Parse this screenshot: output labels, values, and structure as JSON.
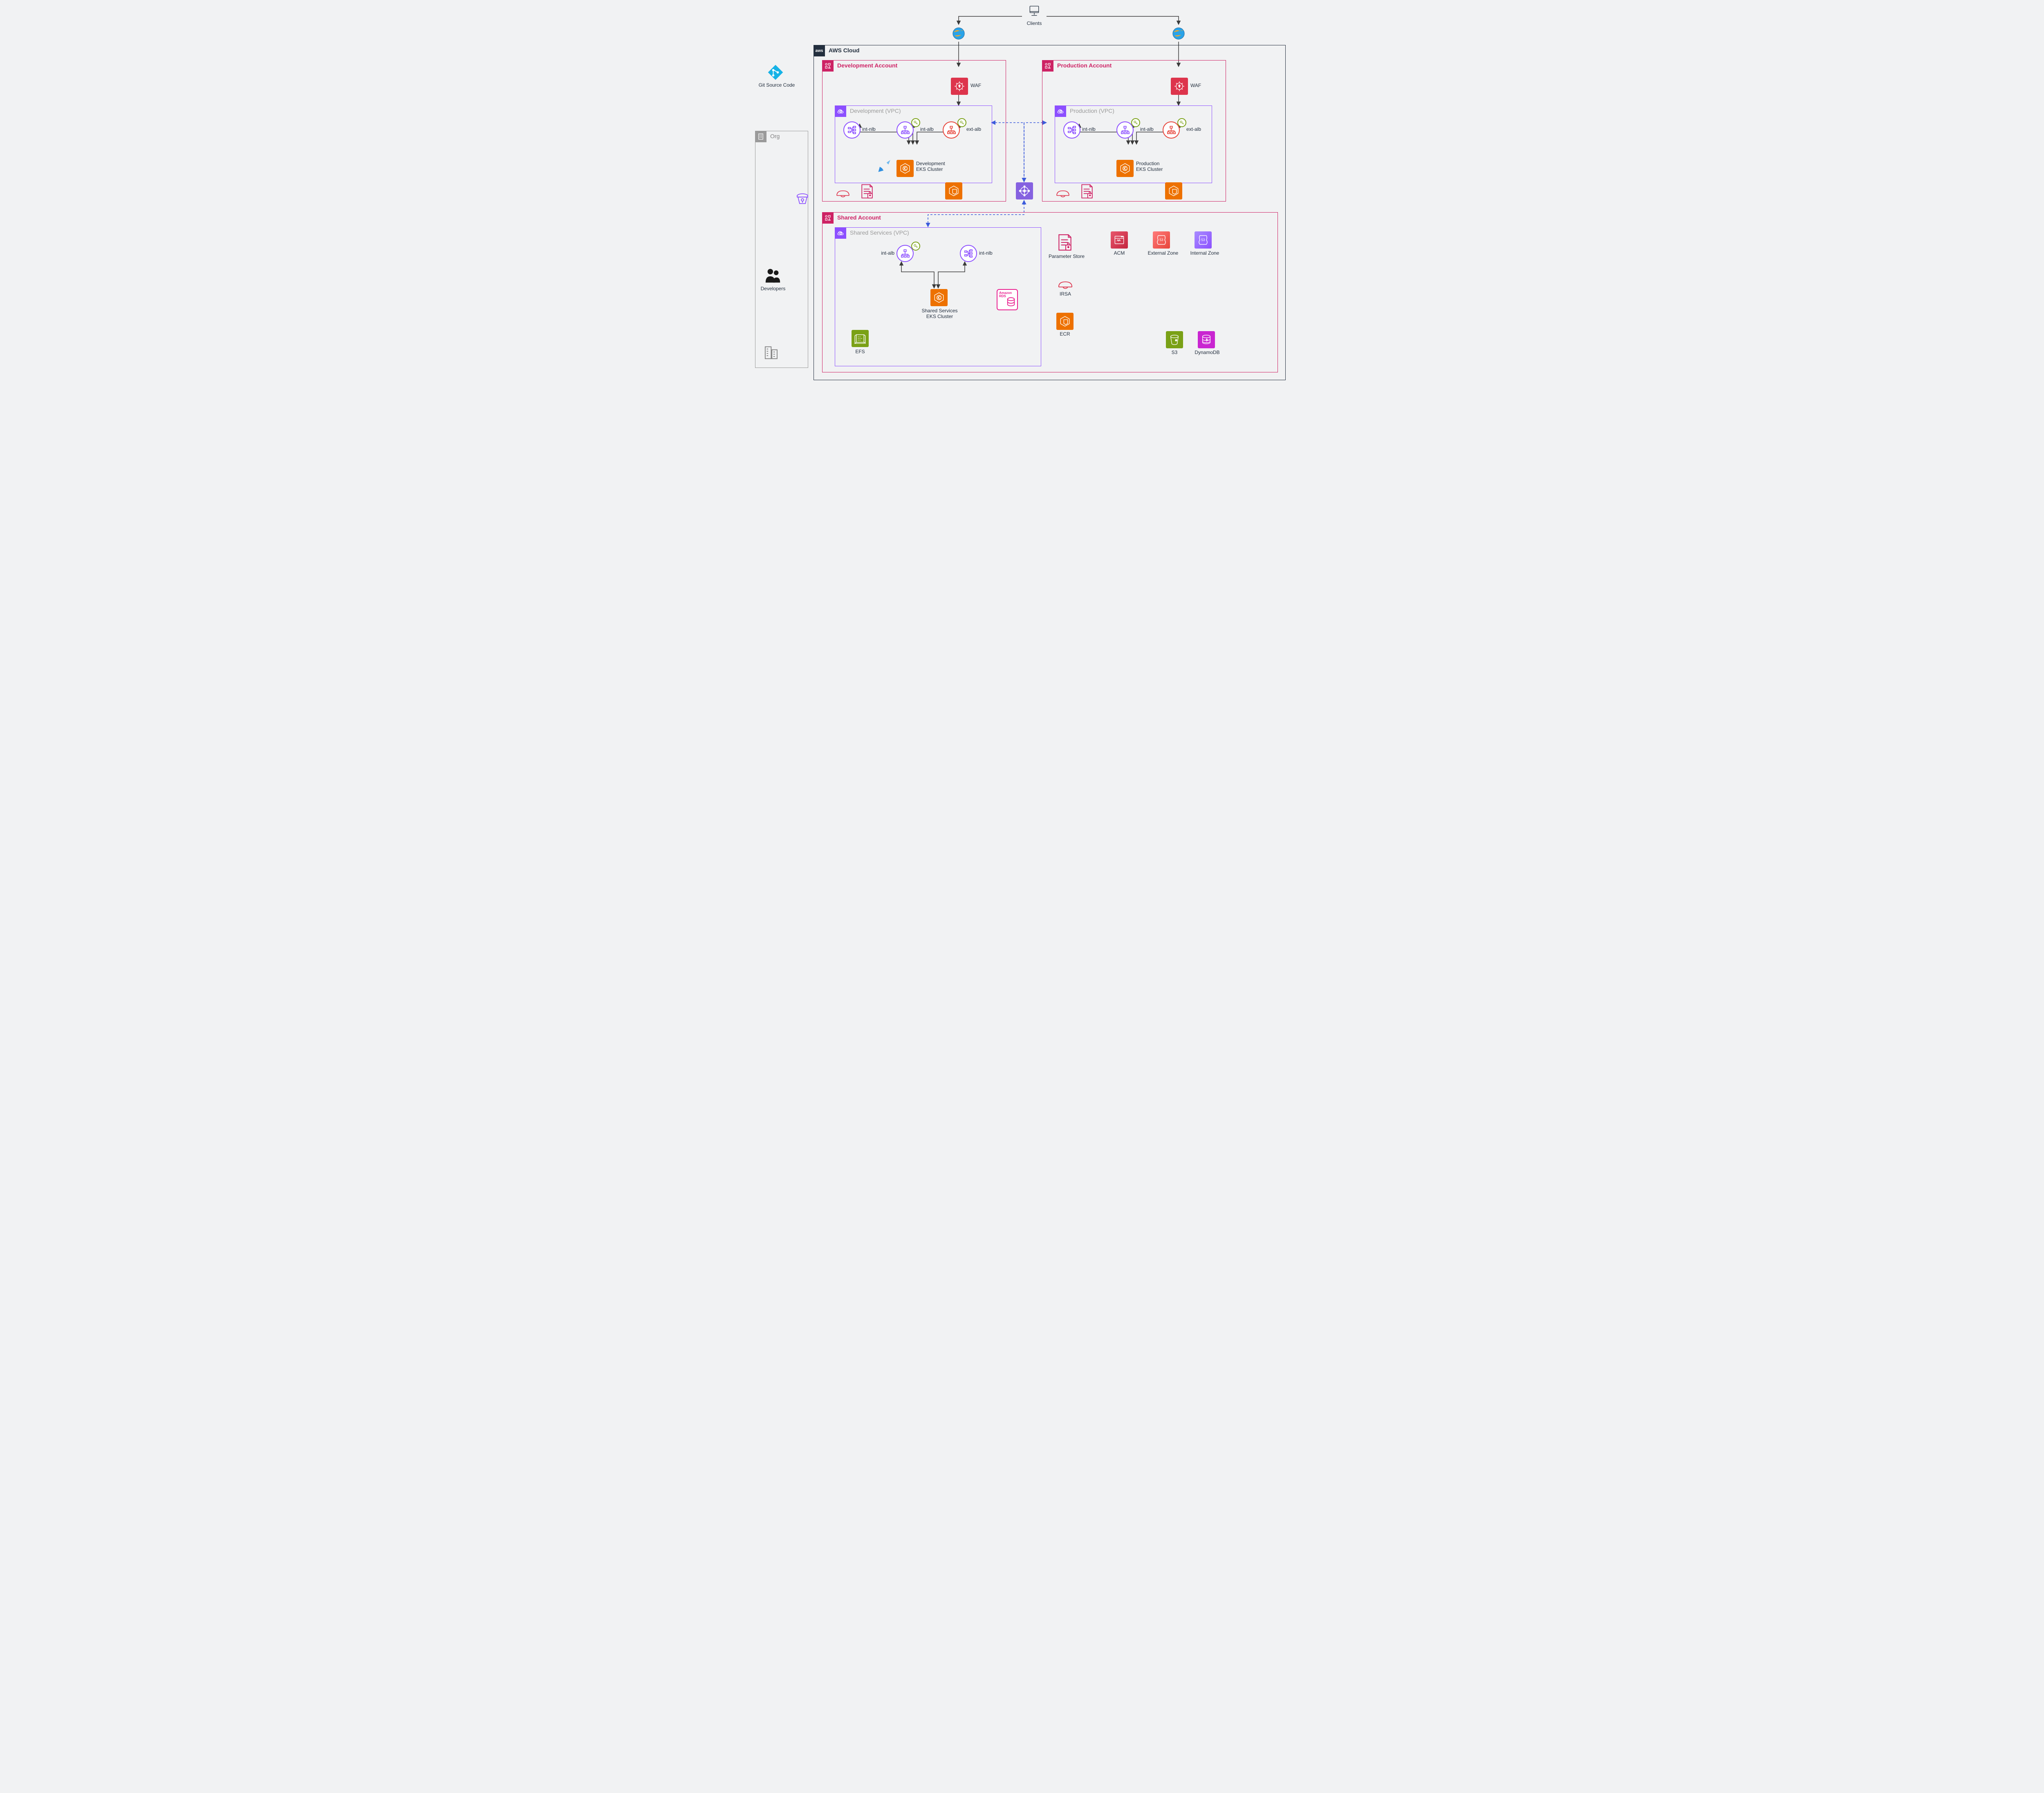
{
  "clients_label": "Clients",
  "git_label": "Git Source Code",
  "developers_label": "Developers",
  "org_label": "Org",
  "aws_cloud_label": "AWS Cloud",
  "dev_account": {
    "title": "Development Account",
    "vpc_title": "Development (VPC)",
    "int_nlb": "int-nlb",
    "int_alb": "int-alb",
    "ext_alb": "ext-alb",
    "eks": "Development\nEKS Cluster",
    "waf": "WAF"
  },
  "prod_account": {
    "title": "Production Account",
    "vpc_title": "Production (VPC)",
    "int_nlb": "int-nlb",
    "int_alb": "int-alb",
    "ext_alb": "ext-alb",
    "eks": "Production\nEKS Cluster",
    "waf": "WAF"
  },
  "shared_account": {
    "title": "Shared Account",
    "vpc_title": "Shared Services (VPC)",
    "int_alb": "int-alb",
    "int_nlb": "int-nlb",
    "eks": "Shared Services\nEKS Cluster",
    "efs": "EFS",
    "rds": "Amazon\nRDS",
    "param_store": "Parameter Store",
    "acm": "ACM",
    "ext_zone": "External Zone",
    "int_zone": "Internal Zone",
    "irsa": "IRSA",
    "ecr": "ECR",
    "s3": "S3",
    "dynamodb": "DynamoDB"
  },
  "colors": {
    "aws_dark": "#232f3e",
    "magenta": "#cd2264",
    "purple": "#8c4fff",
    "orange": "#ed7100",
    "red": "#e7443a",
    "green_olive": "#7aa116",
    "green_bright": "#4caf50",
    "pink": "#e91e63",
    "blue_tgw": "#6b5ce7",
    "route53_red_grad": [
      "#ff6f6f",
      "#e7443a"
    ],
    "route53_purple_grad": [
      "#a084ff",
      "#8c4fff"
    ]
  }
}
